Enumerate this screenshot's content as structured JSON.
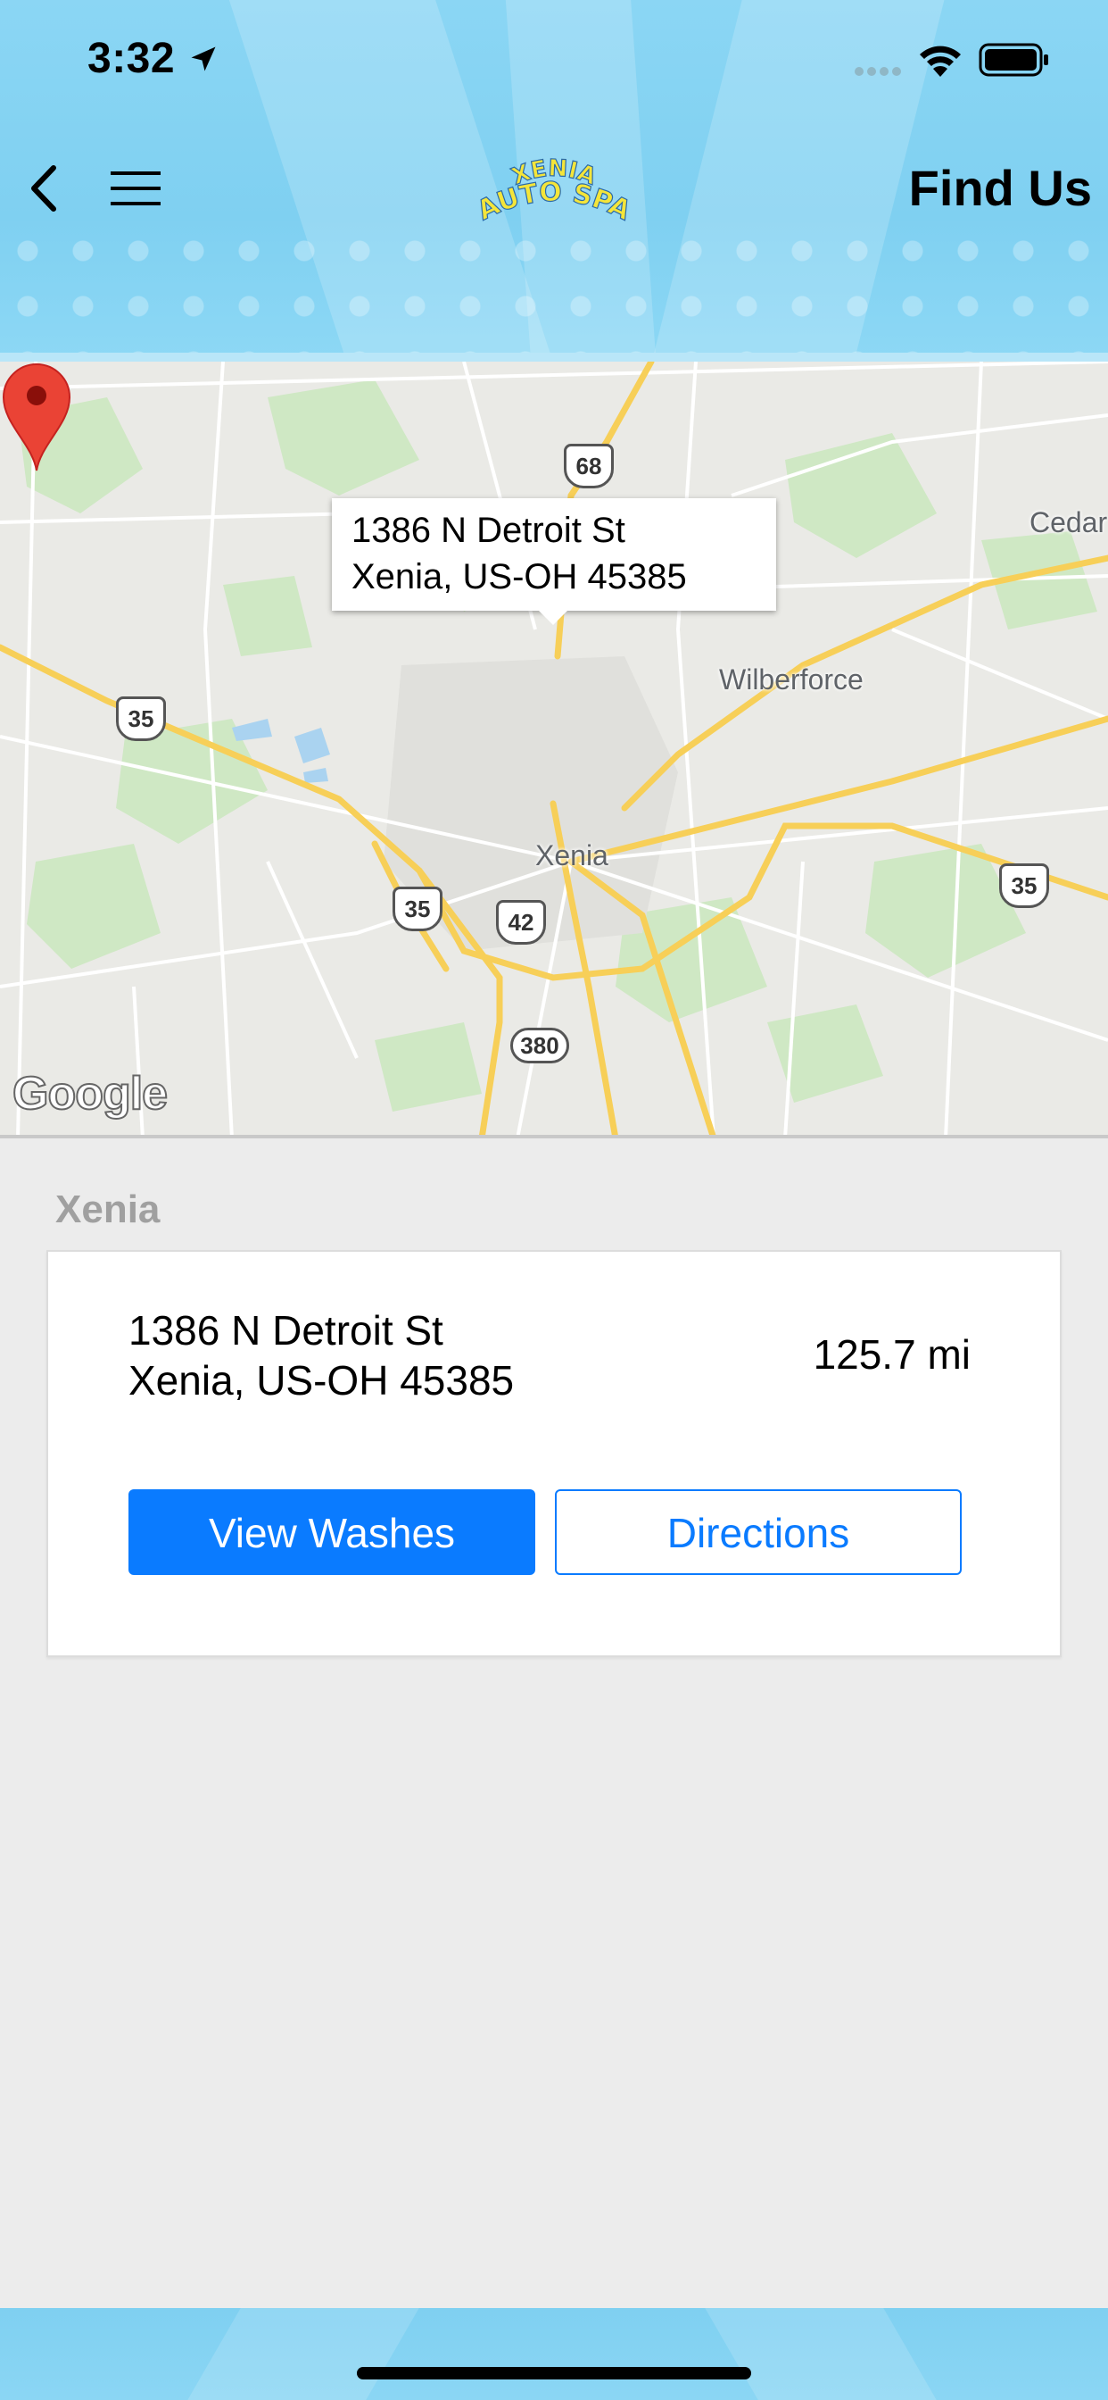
{
  "status_bar": {
    "time": "3:32"
  },
  "header": {
    "title": "Find Us",
    "logo_line1": "XENIA",
    "logo_line2": "AUTO SPA",
    "back_icon": "chevron-left-icon",
    "menu_icon": "hamburger-icon"
  },
  "map": {
    "callout": {
      "line1": "1386 N Detroit St",
      "line2": "Xenia, US-OH  45385"
    },
    "places": {
      "xenia": "Xenia",
      "wilberforce": "Wilberforce",
      "cedar": "Cedar"
    },
    "route_shields": {
      "us68": "68",
      "us35_west": "35",
      "us35_south": "35",
      "us42": "42",
      "us35_east": "35",
      "sr380": "380"
    },
    "attribution": "Google"
  },
  "location": {
    "section_title": "Xenia",
    "address_line1": "1386 N Detroit St",
    "address_line2": "Xenia, US-OH  45385",
    "distance": "125.7 mi",
    "view_washes_label": "View Washes",
    "directions_label": "Directions"
  },
  "colors": {
    "accent": "#0a7bff",
    "header_bg": "#8bd6f4",
    "page_bg": "#ececec",
    "section_title": "#a0a0a0",
    "pin": "#ea4335"
  }
}
